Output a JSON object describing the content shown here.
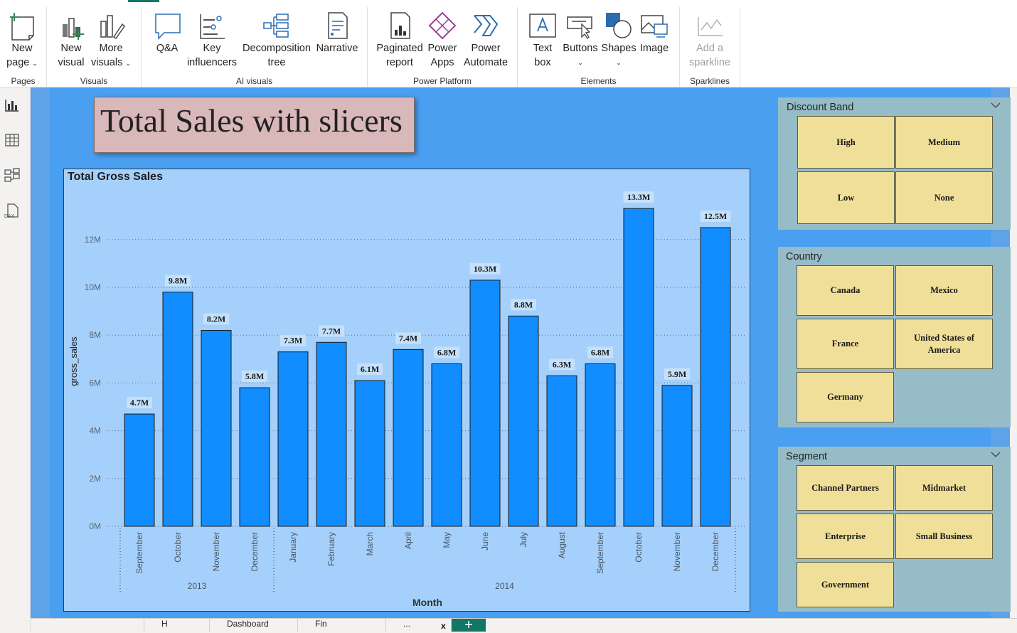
{
  "ribbon": {
    "groups": [
      {
        "label": "Pages",
        "buttons": [
          {
            "line1": "New",
            "line2": "page",
            "caret": true
          }
        ]
      },
      {
        "label": "Visuals",
        "buttons": [
          {
            "line1": "New",
            "line2": "visual"
          },
          {
            "line1": "More",
            "line2": "visuals",
            "caret": true
          }
        ]
      },
      {
        "label": "AI visuals",
        "buttons": [
          {
            "line1": "Q&A",
            "line2": ""
          },
          {
            "line1": "Key",
            "line2": "influencers"
          },
          {
            "line1": "Decomposition",
            "line2": "tree"
          },
          {
            "line1": "Narrative",
            "line2": ""
          }
        ]
      },
      {
        "label": "Power Platform",
        "buttons": [
          {
            "line1": "Paginated",
            "line2": "report"
          },
          {
            "line1": "Power",
            "line2": "Apps"
          },
          {
            "line1": "Power",
            "line2": "Automate"
          }
        ]
      },
      {
        "label": "Elements",
        "buttons": [
          {
            "line1": "Text",
            "line2": "box"
          },
          {
            "line1": "Buttons",
            "line2": "",
            "caret": true
          },
          {
            "line1": "Shapes",
            "line2": "",
            "caret": true
          },
          {
            "line1": "Image",
            "line2": ""
          }
        ]
      },
      {
        "label": "Sparklines",
        "buttons": [
          {
            "line1": "Add a",
            "line2": "sparkline",
            "disabled": true
          }
        ]
      }
    ]
  },
  "report": {
    "title": "Total Sales with slicers",
    "chart_title": "Total Gross Sales"
  },
  "chart_data": {
    "type": "bar",
    "title": "Total Gross Sales",
    "xlabel": "Month",
    "ylabel": "gross_sales",
    "ylim": [
      0,
      14
    ],
    "y_unit": "M",
    "yticks": [
      "0M",
      "2M",
      "4M",
      "6M",
      "8M",
      "10M",
      "12M"
    ],
    "ytick_values": [
      0,
      2,
      4,
      6,
      8,
      10,
      12
    ],
    "color": "#118dff",
    "categories": [
      "September",
      "October",
      "November",
      "December",
      "January",
      "February",
      "March",
      "April",
      "May",
      "June",
      "July",
      "August",
      "September",
      "October",
      "November",
      "December"
    ],
    "values": [
      4.7,
      9.8,
      8.2,
      5.8,
      7.3,
      7.7,
      6.1,
      7.4,
      6.8,
      10.3,
      8.8,
      6.3,
      6.8,
      13.3,
      5.9,
      12.5
    ],
    "data_labels": [
      "4.7M",
      "9.8M",
      "8.2M",
      "5.8M",
      "7.3M",
      "7.7M",
      "6.1M",
      "7.4M",
      "6.8M",
      "10.3M",
      "8.8M",
      "6.3M",
      "6.8M",
      "13.3M",
      "5.9M",
      "12.5M"
    ],
    "groups": [
      {
        "label": "2013",
        "count": 4
      },
      {
        "label": "2014",
        "count": 12
      }
    ],
    "grid": true
  },
  "slicers": {
    "discount_band": {
      "title": "Discount Band",
      "items": [
        "High",
        "Medium",
        "Low",
        "None"
      ]
    },
    "country": {
      "title": "Country",
      "items": [
        "Canada",
        "Mexico",
        "France",
        "United States of America",
        "Germany"
      ]
    },
    "segment": {
      "title": "Segment",
      "items": [
        "Channel Partners",
        "Midmarket",
        "Enterprise",
        "Small Business",
        "Government"
      ]
    }
  },
  "bottom": {
    "tabs": [
      "H",
      "Dashboard",
      "Fin",
      "..."
    ],
    "close": "x",
    "add": "+"
  },
  "colors": {
    "accent": "#117865",
    "canvas": "#4a9ff0",
    "bar": "#118dff",
    "tile": "#f0df98",
    "slicer_bg": "#96bcc8"
  }
}
